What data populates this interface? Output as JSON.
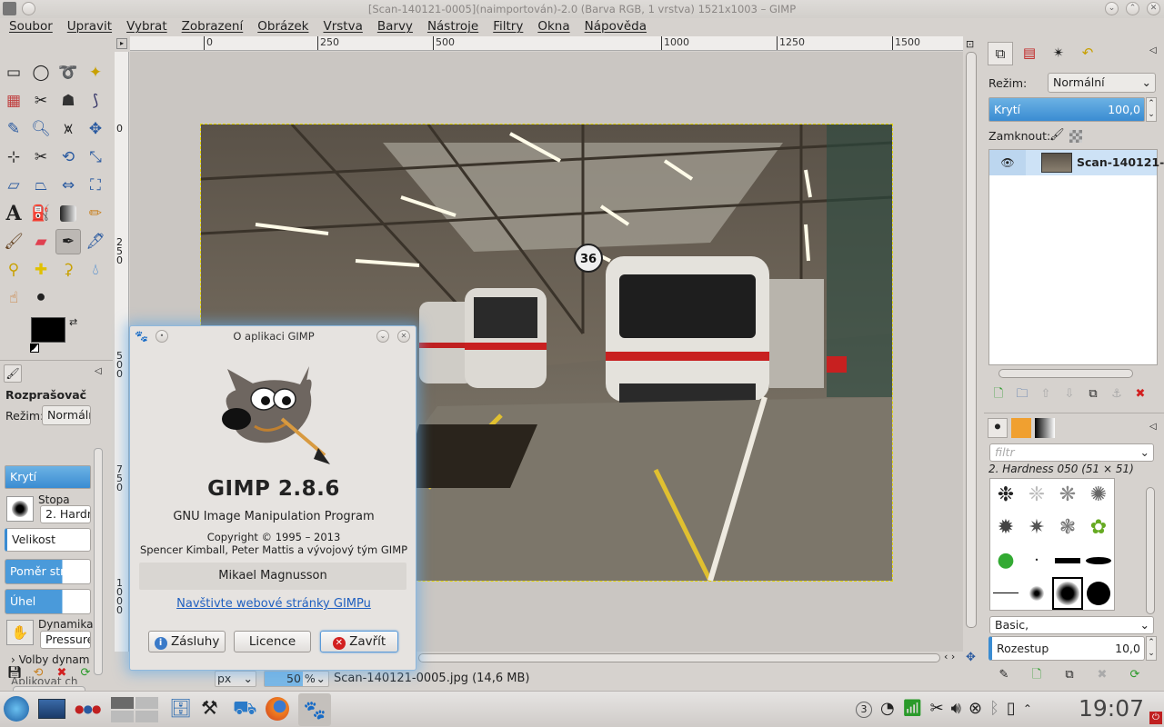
{
  "window": {
    "title": "[Scan-140121-0005](naimportován)-2.0 (Barva RGB, 1 vrstva) 1521x1003 – GIMP"
  },
  "menu": [
    "Soubor",
    "Upravit",
    "Vybrat",
    "Zobrazení",
    "Obrázek",
    "Vrstva",
    "Barvy",
    "Nástroje",
    "Filtry",
    "Okna",
    "Nápověda"
  ],
  "ruler": {
    "top": [
      "0",
      "250",
      "500",
      "1000",
      "1250",
      "1500"
    ],
    "left": [
      "0",
      "2\n5\n0",
      "5\n0\n0",
      "7\n5\n0",
      "1\n0\n0\n0"
    ]
  },
  "tool_options": {
    "title": "Rozprašovač",
    "mode_label": "Režim:",
    "mode_value": "Normální",
    "opacity_label": "Krytí",
    "brush_label": "Stopa",
    "brush_value": "2. Hardn",
    "size_label": "Velikost",
    "aspect_label": "Poměr stran",
    "angle_label": "Úhel",
    "dynamics_label": "Dynamika",
    "dynamics_value": "Pressure",
    "dynamics_opts": "Volby dynam",
    "apply_label": "Aplikovat ch"
  },
  "status": {
    "unit": "px",
    "zoom": "50 %",
    "file": "Scan-140121-0005.jpg (14,6 MB)"
  },
  "layers": {
    "mode_label": "Režim:",
    "mode_value": "Normální",
    "opacity_label": "Krytí",
    "opacity_value": "100,0",
    "lock_label": "Zamknout:",
    "layer_name": "Scan-140121-"
  },
  "brushes": {
    "filter_placeholder": "filtr",
    "current": "2. Hardness 050 (51 × 51)",
    "tag": "Basic,",
    "spacing_label": "Rozestup",
    "spacing_value": "10,0"
  },
  "dialog": {
    "title": "O aplikaci GIMP",
    "version": "GIMP 2.8.6",
    "subtitle": "GNU Image Manipulation Program",
    "copyright": "Copyright © 1995 – 2013",
    "authors": "Spencer Kimball, Peter Mattis a vývojový tým GIMP",
    "contributor": "Mikael Magnusson",
    "link": "Navštivte webové stránky GIMPu",
    "credits_btn": "Zásluhy",
    "license_btn": "Licence",
    "close_btn": "Zavřít"
  },
  "taskbar": {
    "clock": "19:07",
    "badge": "3"
  },
  "colors": {
    "accent": "#3a8cd2",
    "close_red": "#d22020",
    "selection": "#e3d400"
  },
  "photo": {
    "train_number": "36"
  }
}
